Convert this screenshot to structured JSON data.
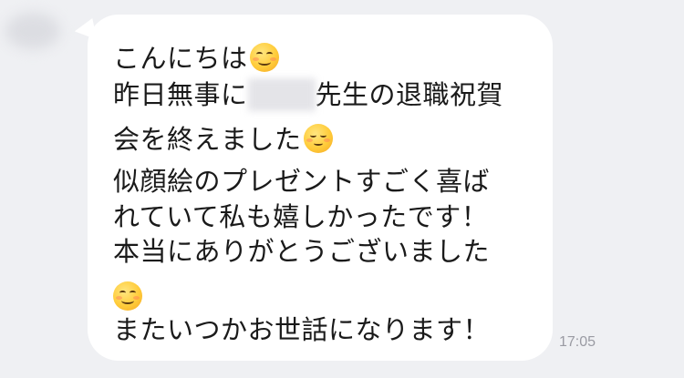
{
  "message": {
    "line1": "こんにちは",
    "line2_before": "昨日無事に",
    "line2_after": "先生の退職祝賀",
    "line3": "会を終えました",
    "line4": "似顔絵のプレゼントすごく喜ば",
    "line5": "れていて私も嬉しかったです！",
    "line6": "本当にありがとうございました",
    "line8": "またいつかお世話になります！",
    "emojis": [
      "smiling-face-icon",
      "relieved-face-icon",
      "smiling-face-icon"
    ],
    "redacted_name": true
  },
  "timestamp": "17:05"
}
